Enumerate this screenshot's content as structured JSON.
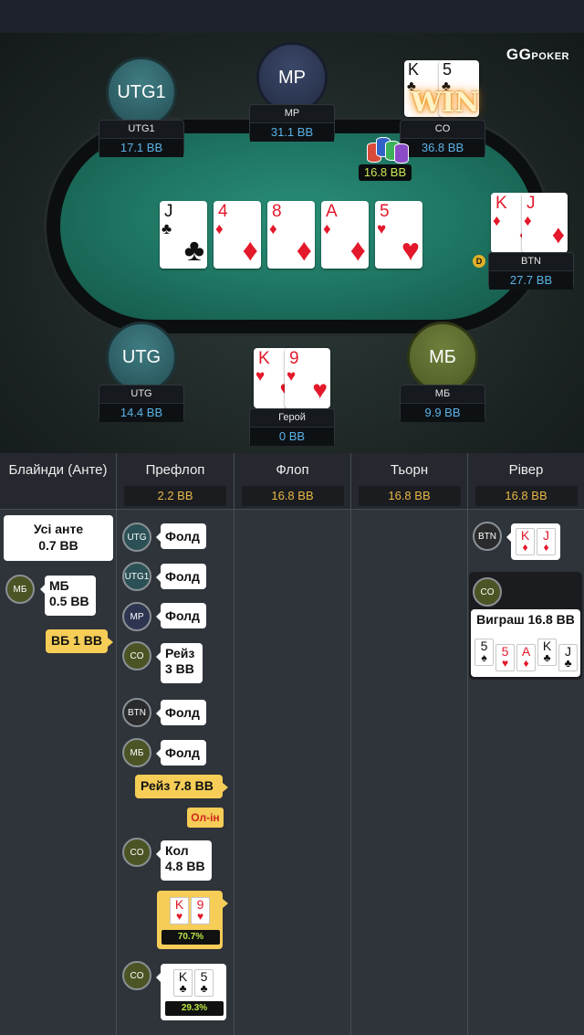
{
  "brand": {
    "logo_main": "GG",
    "logo_sub": "POKER"
  },
  "table": {
    "win_label": "WIN",
    "pot": "16.8 BB",
    "dealer_label": "D",
    "players": [
      {
        "id": "utg1",
        "avatar": "UTG1",
        "name": "UTG1",
        "stack": "17.1 BB"
      },
      {
        "id": "mp",
        "avatar": "MP",
        "name": "MP",
        "stack": "31.1 BB"
      },
      {
        "id": "co",
        "avatar": "",
        "name": "CO",
        "stack": "36.8 BB"
      },
      {
        "id": "btn",
        "avatar": "",
        "name": "BTN",
        "stack": "27.7 BB"
      },
      {
        "id": "mb",
        "avatar": "МБ",
        "name": "МБ",
        "stack": "9.9 BB"
      },
      {
        "id": "hero",
        "avatar": "",
        "name": "Герой",
        "stack": "0 BB"
      },
      {
        "id": "utg",
        "avatar": "UTG",
        "name": "UTG",
        "stack": "14.4 BB"
      }
    ],
    "board": [
      {
        "rank": "J",
        "suit": "♣"
      },
      {
        "rank": "4",
        "suit": "♦"
      },
      {
        "rank": "8",
        "suit": "♦"
      },
      {
        "rank": "A",
        "suit": "♦"
      },
      {
        "rank": "5",
        "suit": "♥"
      }
    ],
    "co_cards": [
      {
        "rank": "K",
        "suit": "♣"
      },
      {
        "rank": "5",
        "suit": "♣"
      }
    ],
    "btn_cards": [
      {
        "rank": "K",
        "suit": "♦"
      },
      {
        "rank": "J",
        "suit": "♦"
      }
    ],
    "hero_cards": [
      {
        "rank": "K",
        "suit": "♥"
      },
      {
        "rank": "9",
        "suit": "♥"
      }
    ]
  },
  "history": {
    "columns": [
      {
        "title": "Блайнди (Анте)",
        "pot": ""
      },
      {
        "title": "Префлоп",
        "pot": "2.2 BB"
      },
      {
        "title": "Флоп",
        "pot": "16.8 BB"
      },
      {
        "title": "Тьорн",
        "pot": "16.8 BB"
      },
      {
        "title": "Рівер",
        "pot": "16.8 BB"
      }
    ],
    "blinds": {
      "ante_line1": "Усі анте",
      "ante_line2": "0.7 BB",
      "sb_badge": "МБ",
      "sb_line1": "МБ",
      "sb_line2": "0.5 BB",
      "bb_action": "ВБ 1 BB"
    },
    "preflop": {
      "utg_badge": "UTG",
      "utg_action": "Фолд",
      "utg1_badge": "UTG1",
      "utg1_action": "Фолд",
      "mp_badge": "MP",
      "mp_action": "Фолд",
      "co_badge": "CO",
      "co_action_1": "Рейз",
      "co_action_2": "3 BB",
      "btn_badge": "BTN",
      "btn_action": "Фолд",
      "mb_badge": "МБ",
      "mb_action": "Фолд",
      "hero_raise": "Рейз 7.8 BB",
      "allin": "Ол-ін",
      "co_call_badge": "CO",
      "co_call_1": "Кол",
      "co_call_2": "4.8 BB",
      "hero_cards": [
        {
          "rank": "K",
          "suit": "♥"
        },
        {
          "rank": "9",
          "suit": "♥"
        }
      ],
      "hero_equity": "70.7%",
      "co_show_badge": "CO",
      "co_cards": [
        {
          "rank": "K",
          "suit": "♣"
        },
        {
          "rank": "5",
          "suit": "♣"
        }
      ],
      "co_equity": "29.3%"
    },
    "river": {
      "btn_badge": "BTN",
      "btn_cards": [
        {
          "rank": "K",
          "suit": "♦"
        },
        {
          "rank": "J",
          "suit": "♦"
        }
      ],
      "co_badge": "CO",
      "win_text": "Виграш 16.8 BB",
      "win_cards": [
        {
          "rank": "5",
          "suit": "♠"
        },
        {
          "rank": "5",
          "suit": "♥"
        },
        {
          "rank": "A",
          "suit": "♦"
        },
        {
          "rank": "K",
          "suit": "♣"
        },
        {
          "rank": "J",
          "suit": "♣"
        }
      ]
    }
  },
  "colors": {
    "felt": "#1d7260",
    "stack_blue": "#5ab3e6",
    "pot_gold": "#e9b745",
    "equity_green": "#b9e541"
  }
}
